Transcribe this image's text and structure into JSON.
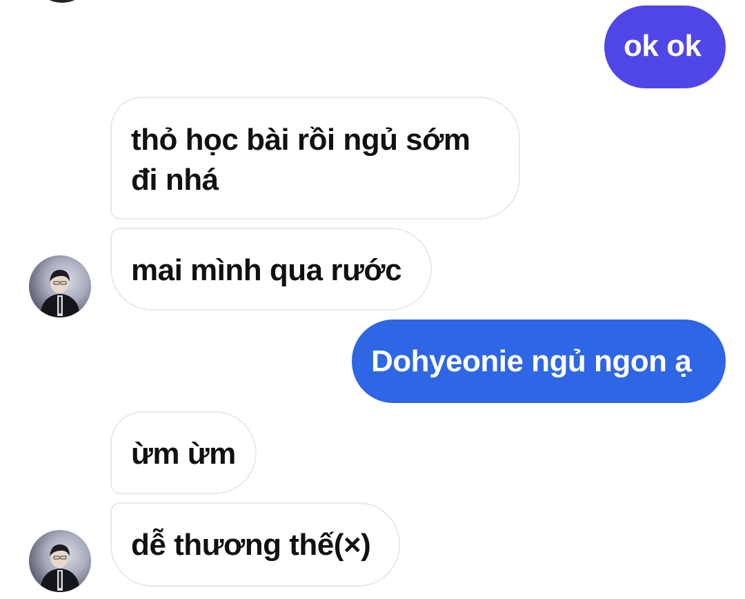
{
  "messages": [
    {
      "id": "m1",
      "side": "out",
      "text": "ok ok",
      "color": "#5046e8"
    },
    {
      "id": "m2",
      "side": "in",
      "lines": [
        "thỏ học bài rồi ngủ sớm",
        "đi nhá"
      ]
    },
    {
      "id": "m3",
      "side": "in",
      "text": "mai mình qua rước"
    },
    {
      "id": "m4",
      "side": "out",
      "text": "Dohyeonie ngủ ngon ạ",
      "color": "#2e66e6"
    },
    {
      "id": "m5",
      "side": "in",
      "text": "ừm ừm"
    },
    {
      "id": "m6",
      "side": "in",
      "text": "dễ thương thế(×)"
    }
  ],
  "colors": {
    "outgoing_top": "#5046e8",
    "outgoing_bottom": "#2e66e6",
    "incoming_bg": "#ffffff",
    "incoming_border": "#e9e9eb",
    "incoming_text": "#111111"
  },
  "icons": {
    "contact_avatar": "avatar-photo"
  }
}
